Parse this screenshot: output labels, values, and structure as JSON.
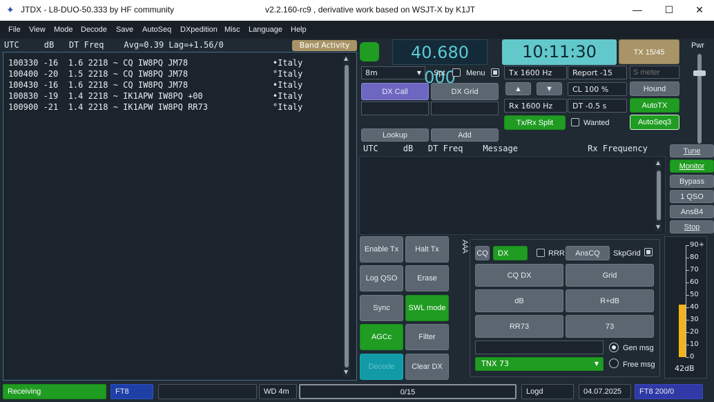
{
  "window": {
    "title": "JTDX - L8-DUO-50.333  by HF community",
    "subtitle": "v2.2.160-rc9 , derivative work based on WSJT-X by K1JT",
    "minimize": "—",
    "maximize": "☐",
    "close": "✕"
  },
  "menu": [
    "File",
    "View",
    "Mode",
    "Decode",
    "Save",
    "AutoSeq",
    "DXpedition",
    "Misc",
    "Language",
    "Help"
  ],
  "band_activity": {
    "header": "UTC     dB   DT Freq    Avg=0.39 Lag=+1.56/0",
    "button": "Band Activity",
    "lines": [
      "100330 -16  1.6 2218 ~ CQ IW8PQ JM78                 •Italy",
      "100400 -20  1.5 2218 ~ CQ IW8PQ JM78                 °Italy",
      "100430 -16  1.6 2218 ~ CQ IW8PQ JM78                 •Italy",
      "100830 -19  1.4 2218 ~ IK1APW IW8PQ +00              •Italy",
      "100900 -21  1.4 2218 ~ IK1APW IW8PQ RR73             °Italy"
    ]
  },
  "top": {
    "frequency": "40.680 000",
    "clock": "10:11:30",
    "tx_period": "TX 15/45",
    "pwr_label": "Pwr",
    "band": "8m",
    "spt": "Spt",
    "menu": "Menu",
    "dx_call": "DX Call",
    "dx_grid": "DX Grid",
    "dx_call_value": "",
    "dx_grid_value": "",
    "lookup": "Lookup",
    "add": "Add",
    "tx_freq": "Tx  1600  Hz",
    "rx_freq": "Rx  1600  Hz",
    "report": "Report -15",
    "smeter_placeholder": "S meter",
    "cl": "CL  100 %",
    "dt": "DT -0.5 s",
    "hound": "Hound",
    "autotx": "AutoTX",
    "autoseq": "AutoSeq3",
    "tx_rx_split": "Tx/Rx Split",
    "wanted": "Wanted",
    "up_arrow": "▲",
    "down_arrow": "▼"
  },
  "rx_panel": {
    "header": "UTC     dB   DT Freq    Message              Rx Frequency"
  },
  "side_buttons": [
    "Tune",
    "Monitor",
    "Bypass",
    "1 QSO",
    "AnsB4",
    "Stop"
  ],
  "control_buttons": {
    "enable_tx": "Enable Tx",
    "halt_tx": "Halt Tx",
    "log_qso": "Log QSO",
    "erase": "Erase",
    "sync": "Sync",
    "swl_mode": "SWL mode",
    "agcc": "AGCc",
    "filter": "Filter",
    "decode": "Decode",
    "clear_dx": "Clear DX"
  },
  "msg_panel": {
    "cq": "CQ",
    "dx": "DX",
    "rrr": "RRR",
    "anscq": "AnsCQ",
    "skpgrid": "SkpGrid",
    "cq_dx": "CQ DX",
    "grid": "Grid",
    "db": "dB",
    "r_db": "R+dB",
    "rr73": "RR73",
    "n73": "73",
    "gen_msg": "Gen msg",
    "free_msg": "Free msg",
    "free_text": "TNX 73",
    "arrows": "AAA"
  },
  "meter": {
    "ticks": [
      "90+",
      "80",
      "70",
      "60",
      "50",
      "40",
      "30",
      "20",
      "10",
      "0"
    ],
    "level_db": 42,
    "label": "42dB"
  },
  "status": {
    "state": "Receiving",
    "mode": "FT8",
    "wd": "WD 4m",
    "progress": "0/15",
    "logd": "Logd",
    "date": "04.07.2025",
    "mode_rate": "FT8  200/0"
  },
  "colors": {
    "green": "#1f9c21",
    "teal": "#63c8cc",
    "gold": "#a89466",
    "dxcall": "#6e67c2",
    "meter": "#f2b31c"
  }
}
